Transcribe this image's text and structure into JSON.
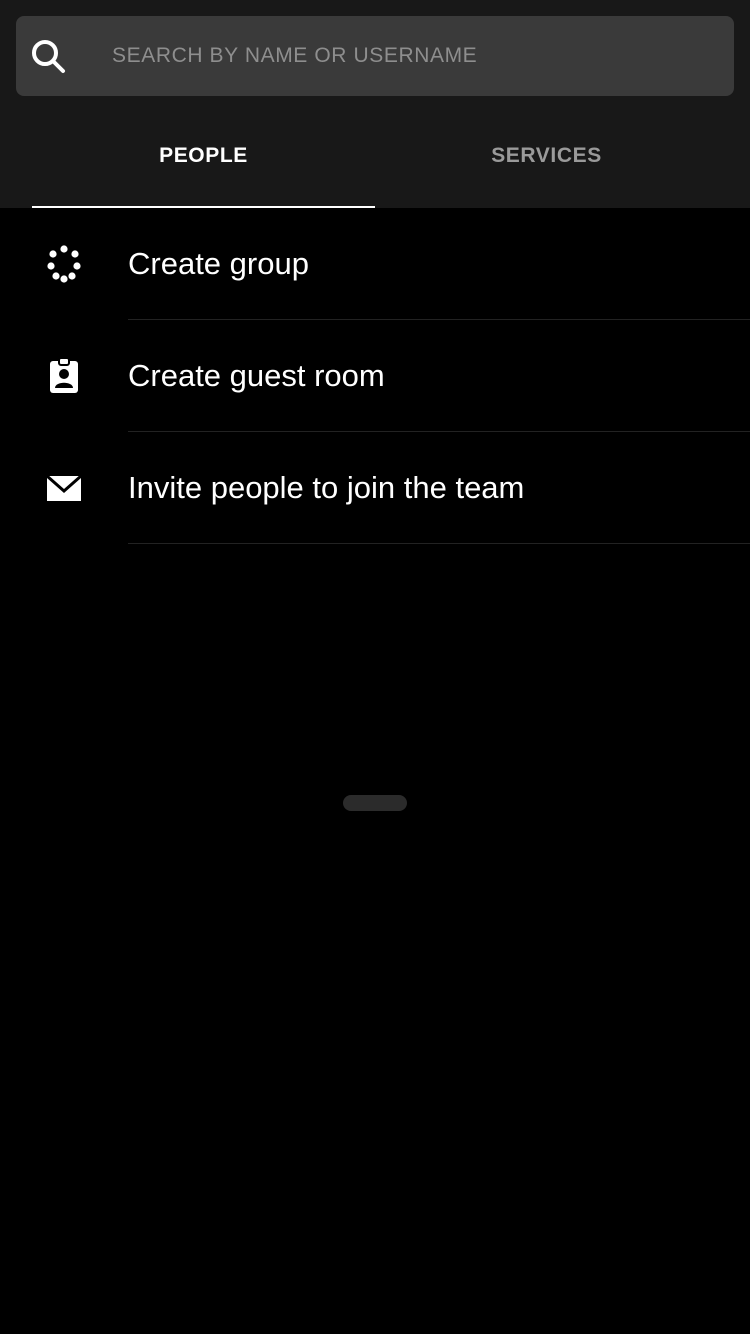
{
  "search": {
    "placeholder": "SEARCH BY NAME OR USERNAME",
    "value": "",
    "icon": "search-icon"
  },
  "tabs": [
    {
      "label": "PEOPLE",
      "active": true
    },
    {
      "label": "SERVICES",
      "active": false
    }
  ],
  "actions": [
    {
      "label": "Create group",
      "icon": "group-icon"
    },
    {
      "label": "Create guest room",
      "icon": "badge-icon"
    },
    {
      "label": "Invite people to join the team",
      "icon": "mail-icon"
    }
  ],
  "colors": {
    "background": "#000000",
    "header": "#181818",
    "search_field": "#3a3a3a",
    "text": "#ffffff",
    "inactive_tab": "#9a9a9a"
  }
}
